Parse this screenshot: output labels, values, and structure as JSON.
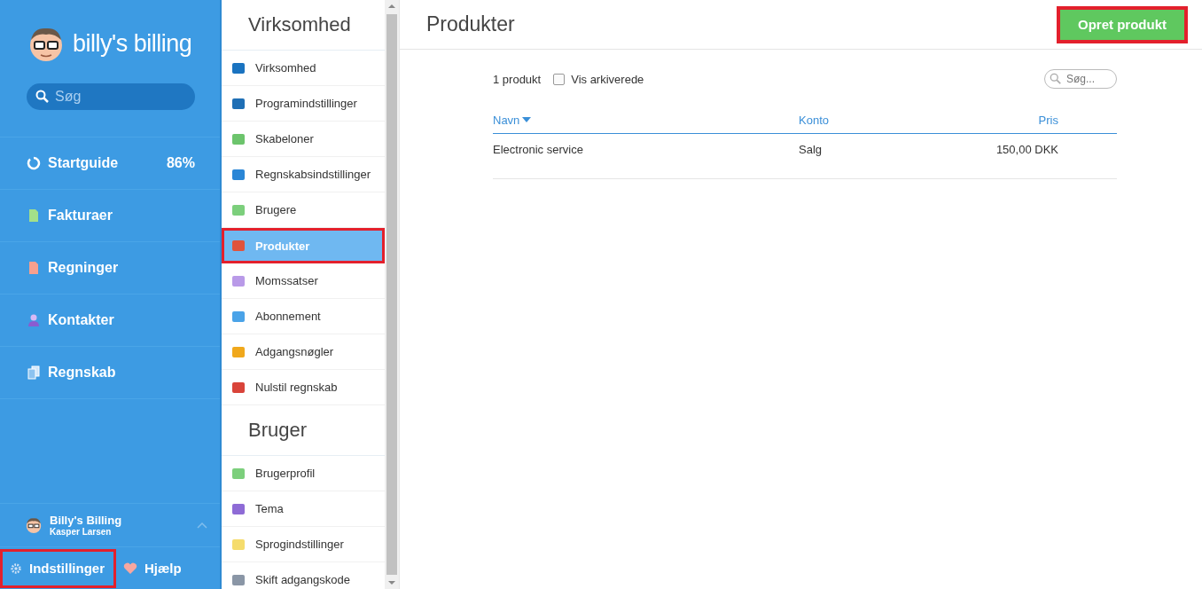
{
  "sidebar": {
    "logo_text": "billy's billing",
    "search": {
      "placeholder": "Søg"
    },
    "items": [
      {
        "label": "Startguide",
        "badge": "86%",
        "kind": "progress"
      },
      {
        "label": "Fakturaer",
        "kind": "invoice"
      },
      {
        "label": "Regninger",
        "kind": "bill"
      },
      {
        "label": "Kontakter",
        "kind": "contact"
      },
      {
        "label": "Regnskab",
        "kind": "ledger"
      }
    ],
    "account": {
      "company": "Billy's Billing",
      "user": "Kasper Larsen"
    },
    "bottom": [
      {
        "label": "Indstillinger",
        "kind": "settings",
        "highlighted": true
      },
      {
        "label": "Hjælp",
        "kind": "help",
        "highlighted": false
      }
    ]
  },
  "settings_menu": {
    "sections": [
      {
        "title": "Virksomhed",
        "items": [
          {
            "label": "Virksomhed",
            "selected": false,
            "highlighted": false
          },
          {
            "label": "Programindstillinger",
            "selected": false,
            "highlighted": false
          },
          {
            "label": "Skabeloner",
            "selected": false,
            "highlighted": false
          },
          {
            "label": "Regnskabsindstillinger",
            "selected": false,
            "highlighted": false
          },
          {
            "label": "Brugere",
            "selected": false,
            "highlighted": false
          },
          {
            "label": "Produkter",
            "selected": true,
            "highlighted": true
          },
          {
            "label": "Momssatser",
            "selected": false,
            "highlighted": false
          },
          {
            "label": "Abonnement",
            "selected": false,
            "highlighted": false
          },
          {
            "label": "Adgangsnøgler",
            "selected": false,
            "highlighted": false
          },
          {
            "label": "Nulstil regnskab",
            "selected": false,
            "highlighted": false
          }
        ]
      },
      {
        "title": "Bruger",
        "items": [
          {
            "label": "Brugerprofil",
            "selected": false,
            "highlighted": false
          },
          {
            "label": "Tema",
            "selected": false,
            "highlighted": false
          },
          {
            "label": "Sprogindstillinger",
            "selected": false,
            "highlighted": false
          },
          {
            "label": "Skift adgangskode",
            "selected": false,
            "highlighted": false
          }
        ]
      }
    ]
  },
  "page": {
    "title": "Produkter",
    "create_button": {
      "label": "Opret produkt",
      "highlighted": true
    },
    "count": "1 produkt",
    "show_archived": {
      "label": "Vis arkiverede",
      "checked": false
    },
    "search": {
      "placeholder": "Søg..."
    },
    "table": {
      "columns": [
        {
          "label": "Navn",
          "sorted": true
        },
        {
          "label": "Konto",
          "sorted": false
        },
        {
          "label": "Pris",
          "sorted": false
        }
      ],
      "rows": [
        [
          "Electronic service",
          "Salg",
          "150,00 DKK"
        ]
      ]
    }
  }
}
